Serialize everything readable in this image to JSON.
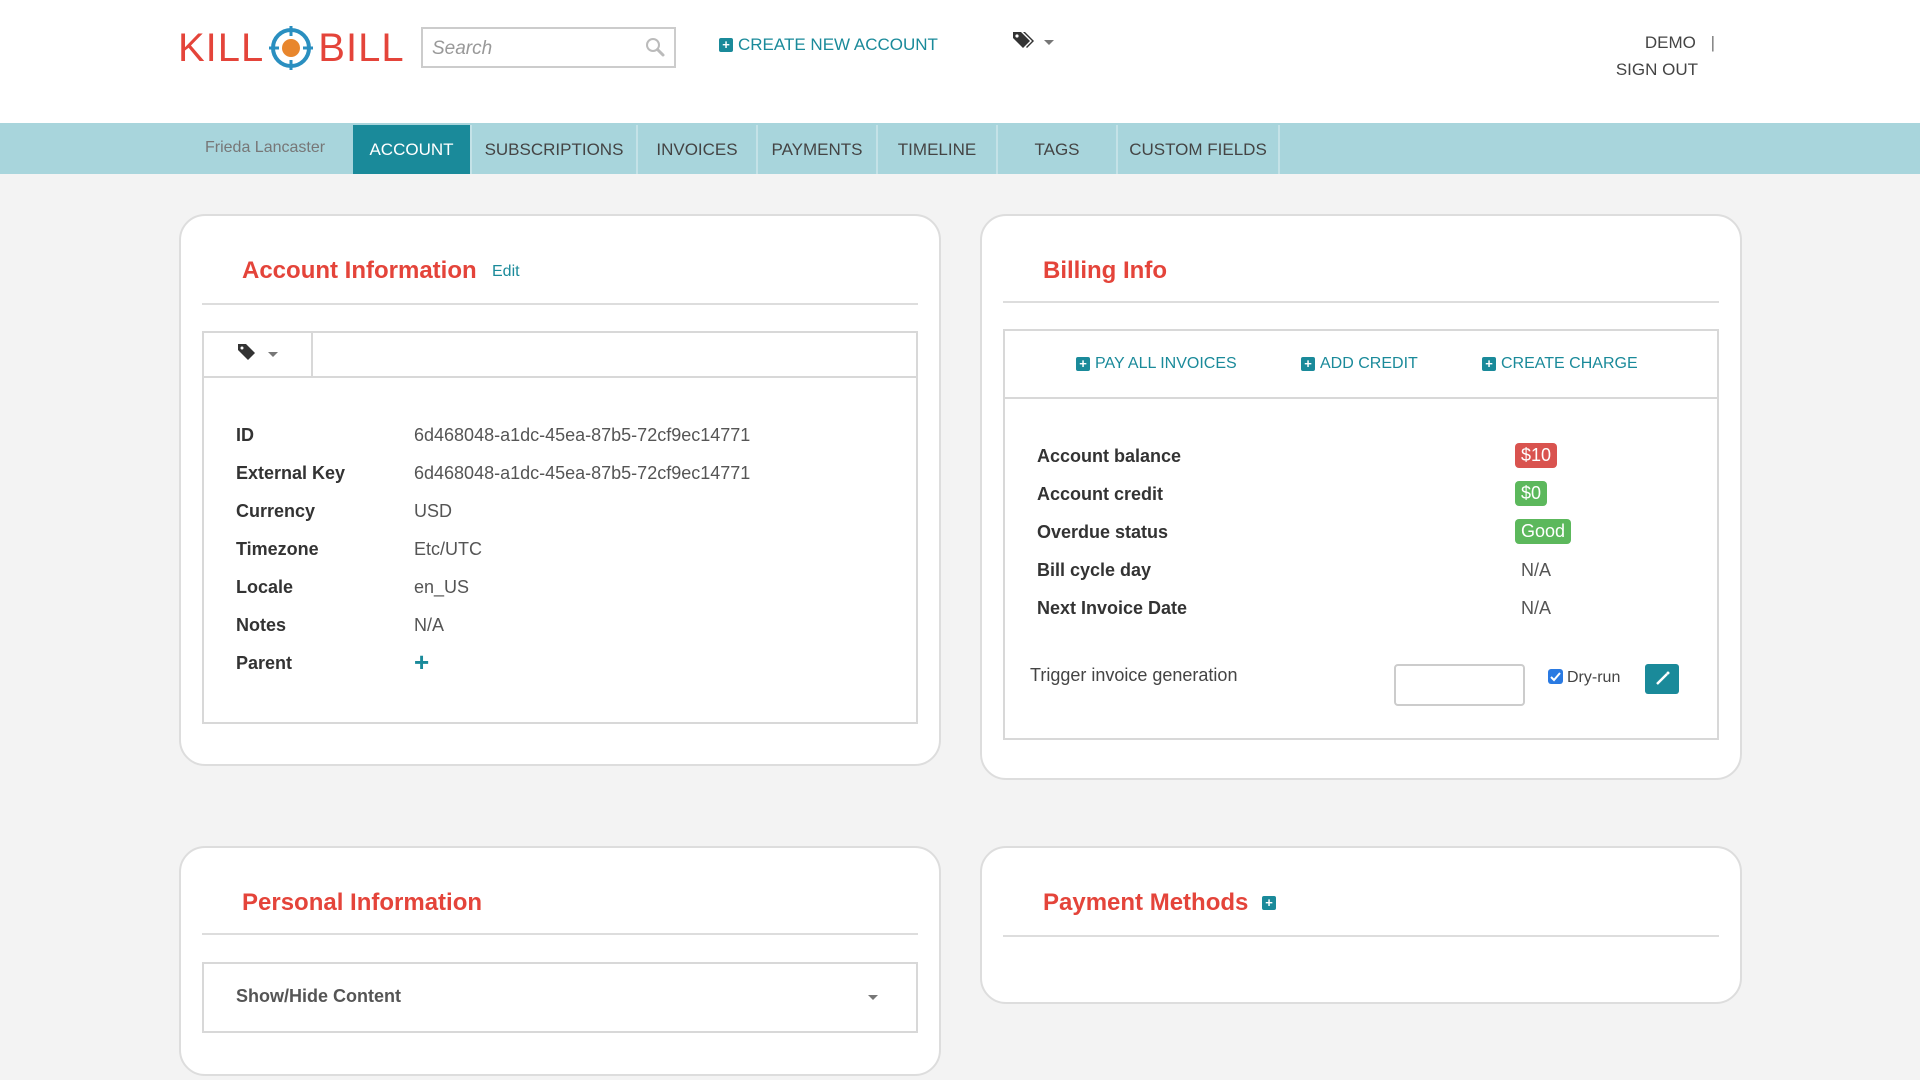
{
  "header": {
    "logo_left": "KILL",
    "logo_right": "BILL",
    "search_placeholder": "Search",
    "create_account": "CREATE NEW ACCOUNT",
    "user": "DEMO",
    "user_separator": "|",
    "sign_out": "SIGN OUT"
  },
  "nav": {
    "account_name": "Frieda Lancaster",
    "tabs": [
      "ACCOUNT",
      "SUBSCRIPTIONS",
      "INVOICES",
      "PAYMENTS",
      "TIMELINE",
      "TAGS",
      "CUSTOM FIELDS"
    ],
    "active_tab": "ACCOUNT"
  },
  "account_info": {
    "title": "Account Information",
    "edit": "Edit",
    "fields": [
      {
        "label": "ID",
        "value": "6d468048-a1dc-45ea-87b5-72cf9ec14771"
      },
      {
        "label": "External Key",
        "value": "6d468048-a1dc-45ea-87b5-72cf9ec14771"
      },
      {
        "label": "Currency",
        "value": "USD"
      },
      {
        "label": "Timezone",
        "value": "Etc/UTC"
      },
      {
        "label": "Locale",
        "value": "en_US"
      },
      {
        "label": "Notes",
        "value": "N/A"
      },
      {
        "label": "Parent",
        "value": "+"
      }
    ]
  },
  "billing_info": {
    "title": "Billing Info",
    "actions": [
      "PAY ALL INVOICES",
      "ADD CREDIT",
      "CREATE CHARGE"
    ],
    "rows": [
      {
        "label": "Account balance",
        "value": "$10",
        "style": "red"
      },
      {
        "label": "Account credit",
        "value": "$0",
        "style": "green"
      },
      {
        "label": "Overdue status",
        "value": "Good",
        "style": "green"
      },
      {
        "label": "Bill cycle day",
        "value": "N/A",
        "style": "plain"
      },
      {
        "label": "Next Invoice Date",
        "value": "N/A",
        "style": "plain"
      }
    ],
    "trigger_label": "Trigger invoice generation",
    "trigger_value": "",
    "dry_run_label": "Dry-run",
    "dry_run_checked": true
  },
  "personal_info": {
    "title": "Personal Information",
    "toggle": "Show/Hide Content"
  },
  "payment_methods": {
    "title": "Payment Methods"
  },
  "colors": {
    "accent": "#1a8a9a",
    "brand_red": "#e4443a",
    "nav_bg": "#a8d5dc",
    "badge_red": "#d9534f",
    "badge_green": "#5cb85c"
  }
}
